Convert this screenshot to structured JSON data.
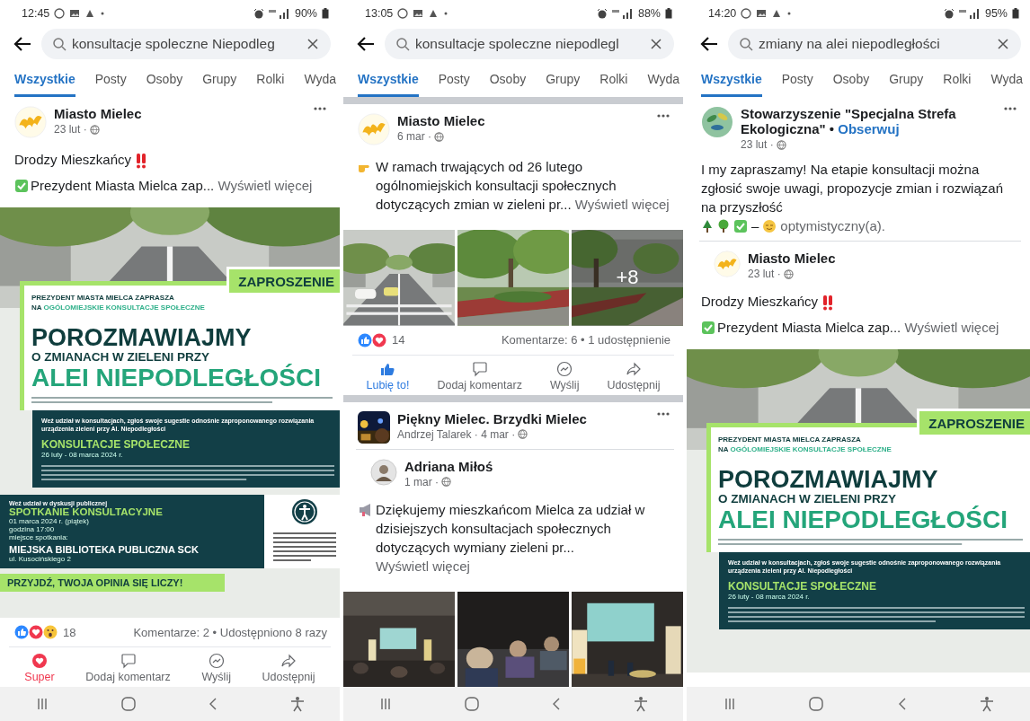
{
  "phones": [
    {
      "status": {
        "time": "12:45",
        "battery": "90%"
      },
      "search": {
        "query": "konsultacje spoleczne Niepodleg"
      },
      "tabs": [
        {
          "label": "Wszystkie",
          "selected": true
        },
        {
          "label": "Posty",
          "selected": false
        },
        {
          "label": "Osoby",
          "selected": false
        },
        {
          "label": "Grupy",
          "selected": false
        },
        {
          "label": "Rolki",
          "selected": false
        },
        {
          "label": "Wyda",
          "selected": false
        }
      ],
      "feed": [
        {
          "kind": "post",
          "author": "Miasto Mielec",
          "date": "23 lut ·",
          "lines": [
            {
              "kind": "alert",
              "text": "Drodzy Mieszkańcy"
            },
            {
              "kind": "check",
              "text": "Prezydent Miasta Mielca zap...",
              "more": "Wyświetl więcej"
            }
          ],
          "poster": {
            "tag": "ZAPROSZENIE",
            "invite": [
              "PREZYDENT MIASTA MIELCA ZAPRASZA",
              "NA **OGÓLOMIEJSKIE KONSULTACJE SPOŁECZNE**"
            ],
            "headline": "POROZMAWIAJMY",
            "subline": "O ZMIANACH W ZIELENI PRZY",
            "place": "ALEI NIEPODLEGŁOŚCI",
            "box": {
              "intro": "Weź udział w konsultacjach, zgłoś swoje sugestie odnośnie zaproponowanego rozwiązania urządzenia zieleni przy Al. Niepodległości",
              "title": "KONSULTACJE SPOŁECZNE",
              "dates": "26 luty - 08 marca 2024 r."
            },
            "meeting": {
              "intro": "Weź udział w dyskusji publicznej",
              "title": "SPOTKANIE KONSULTACYJNE",
              "details": [
                "01 marca 2024 r. (piątek)",
                "godzina 17:00",
                "miejsce spotkania:"
              ],
              "venue": "MIEJSKA BIBLIOTEKA PUBLICZNA SCK",
              "address": "ul. Kusocińskiego 2"
            },
            "footer": "PRZYJDŹ, TWOJA OPINIA SIĘ LICZY!"
          },
          "reactions": {
            "icons": [
              {
                "kind": "like"
              },
              {
                "kind": "love"
              },
              {
                "kind": "wow"
              }
            ],
            "count": "18"
          },
          "stats": "Komentarze: 2 • Udostępniono 8 razy",
          "actions": [
            {
              "kind": "love",
              "label": "Super",
              "selected": true
            },
            {
              "kind": "comment",
              "label": "Dodaj komentarz",
              "selected": false
            },
            {
              "kind": "send",
              "label": "Wyślij",
              "selected": false
            },
            {
              "kind": "share",
              "label": "Udostępnij",
              "selected": false
            }
          ]
        }
      ]
    },
    {
      "status": {
        "time": "13:05",
        "battery": "88%"
      },
      "search": {
        "query": "konsultacje spoleczne niepodlegl"
      },
      "tabs": [
        {
          "label": "Wszystkie",
          "selected": true
        },
        {
          "label": "Posty",
          "selected": false
        },
        {
          "label": "Osoby",
          "selected": false
        },
        {
          "label": "Grupy",
          "selected": false
        },
        {
          "label": "Rolki",
          "selected": false
        },
        {
          "label": "Wyda",
          "selected": false
        }
      ],
      "feed": [
        {
          "kind": "post",
          "author": "Miasto Mielec",
          "date": "6 mar ·",
          "lines": [
            {
              "kind": "point",
              "text": "W ramach trwających od 26 lutego ogólnomiejskich konsultacji społecznych dotyczących zmian w zieleni pr...",
              "more": "Wyświetl więcej"
            }
          ],
          "gallery": {
            "kind": "renderings",
            "overlay": "+8"
          },
          "reactions": {
            "icons": [
              {
                "kind": "like"
              },
              {
                "kind": "love"
              }
            ],
            "count": "14"
          },
          "stats": "Komentarze: 6 • 1 udostępnienie",
          "actions": [
            {
              "kind": "like",
              "label": "Lubię to!",
              "selected": true
            },
            {
              "kind": "comment",
              "label": "Dodaj komentarz",
              "selected": false
            },
            {
              "kind": "send",
              "label": "Wyślij",
              "selected": false
            },
            {
              "kind": "share",
              "label": "Udostępnij",
              "selected": false
            }
          ]
        },
        {
          "kind": "group",
          "group": "Piękny Mielec. Brzydki Mielec",
          "byline": "Andrzej Talarek · 4 mar ·",
          "shared": {
            "author": "Adriana Miłoś",
            "date": "1 mar ·",
            "lines": [
              {
                "kind": "megaphone",
                "text": "Dziękujemy mieszkańcom Mielca za udział w dzisiejszych konsultacjach społecznych dotyczących wymiany zieleni pr...",
                "more": "Wyświetl więcej"
              }
            ],
            "gallery": {
              "kind": "event"
            }
          }
        }
      ]
    },
    {
      "status": {
        "time": "14:20",
        "battery": "95%"
      },
      "search": {
        "query": "zmiany na alei niepodległości"
      },
      "tabs": [
        {
          "label": "Wszystkie",
          "selected": true
        },
        {
          "label": "Posty",
          "selected": false
        },
        {
          "label": "Osoby",
          "selected": false
        },
        {
          "label": "Grupy",
          "selected": false
        },
        {
          "label": "Rolki",
          "selected": false
        },
        {
          "label": "Wyda",
          "selected": false
        }
      ],
      "feed": [
        {
          "kind": "page",
          "author": "Stowarzyszenie \"Specjalna Strefa Ekologiczna\"",
          "separator": "•",
          "follow": "Obserwuj",
          "date": "23 lut ·",
          "text": "I my zapraszamy! Na etapie konsultacji można zgłosić swoje uwagi, propozycje zmian i rozwiązań na przyszłość",
          "feeling": {
            "dash": "–",
            "label": "optymistyczny(a)."
          },
          "shared": {
            "author": "Miasto Mielec",
            "date": "23 lut ·",
            "lines": [
              {
                "kind": "alert",
                "text": "Drodzy Mieszkańcy"
              },
              {
                "kind": "check",
                "text": "Prezydent Miasta Mielca zap...",
                "more": "Wyświetl więcej"
              }
            ],
            "poster": {
              "tag": "ZAPROSZENIE",
              "invite": [
                "PREZYDENT MIASTA MIELCA ZAPRASZA",
                "NA **OGÓLOMIEJSKIE KONSULTACJE SPOŁECZNE**"
              ],
              "headline": "POROZMAWIAJMY",
              "subline": "O ZMIANACH W ZIELENI PRZY",
              "place": "ALEI NIEPODLEGŁOŚCI",
              "box": {
                "intro": "Weź udział w konsultacjach, zgłoś swoje sugestie odnośnie zaproponowanego rozwiązania urządzenia zieleni przy Al. Niepodległości",
                "title": "KONSULTACJE SPOŁECZNE",
                "dates": "26 luty - 08 marca 2024 r."
              }
            }
          }
        }
      ]
    }
  ]
}
